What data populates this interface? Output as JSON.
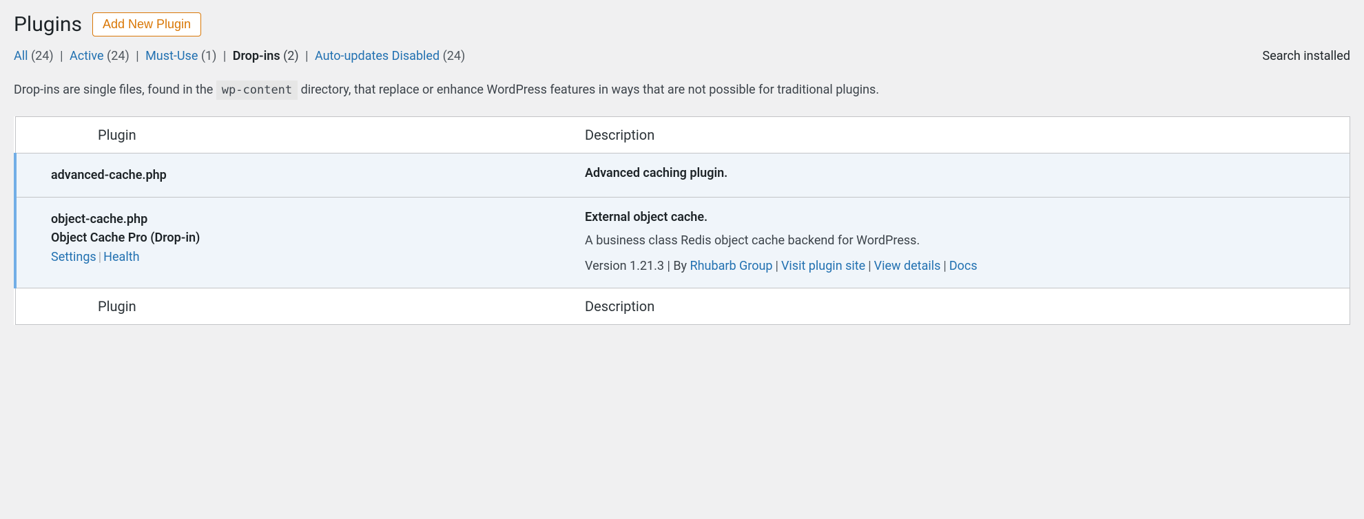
{
  "header": {
    "title": "Plugins",
    "add_new_label": "Add New Plugin"
  },
  "filters": {
    "all": {
      "label": "All",
      "count": "(24)"
    },
    "active": {
      "label": "Active",
      "count": "(24)"
    },
    "mustuse": {
      "label": "Must-Use",
      "count": "(1)"
    },
    "dropins": {
      "label": "Drop-ins",
      "count": "(2)"
    },
    "autoupdates": {
      "label": "Auto-updates Disabled",
      "count": "(24)"
    }
  },
  "search_label": "Search installed",
  "dropins_desc": {
    "pre": "Drop-ins are single files, found in the ",
    "code": "wp-content",
    "post": " directory, that replace or enhance WordPress features in ways that are not possible for traditional plugins."
  },
  "table": {
    "head_plugin": "Plugin",
    "head_desc": "Description",
    "foot_plugin": "Plugin",
    "foot_desc": "Description"
  },
  "rows": [
    {
      "name_lines": [
        "advanced-cache.php"
      ],
      "actions": [],
      "desc_strong": "Advanced caching plugin.",
      "desc_para": "",
      "meta_prefix": "",
      "meta_links": []
    },
    {
      "name_lines": [
        "object-cache.php",
        "Object Cache Pro (Drop-in)"
      ],
      "actions": [
        "Settings",
        "Health"
      ],
      "desc_strong": "External object cache.",
      "desc_para": "A business class Redis object cache backend for WordPress.",
      "meta_prefix": "Version 1.21.3 | By ",
      "meta_links": [
        "Rhubarb Group",
        "Visit plugin site",
        "View details",
        "Docs"
      ]
    }
  ]
}
